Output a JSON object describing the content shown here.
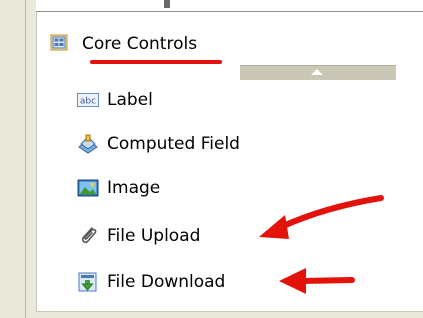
{
  "palette": {
    "drawer_title": "Core Controls",
    "items": [
      {
        "label": "Label",
        "icon": "label-abc-icon"
      },
      {
        "label": "Computed Field",
        "icon": "computed-field-icon"
      },
      {
        "label": "Image",
        "icon": "image-icon"
      },
      {
        "label": "File Upload",
        "icon": "paperclip-icon"
      },
      {
        "label": "File Download",
        "icon": "file-download-icon"
      }
    ]
  },
  "annotations": {
    "highlight_color": "#e3120b"
  }
}
